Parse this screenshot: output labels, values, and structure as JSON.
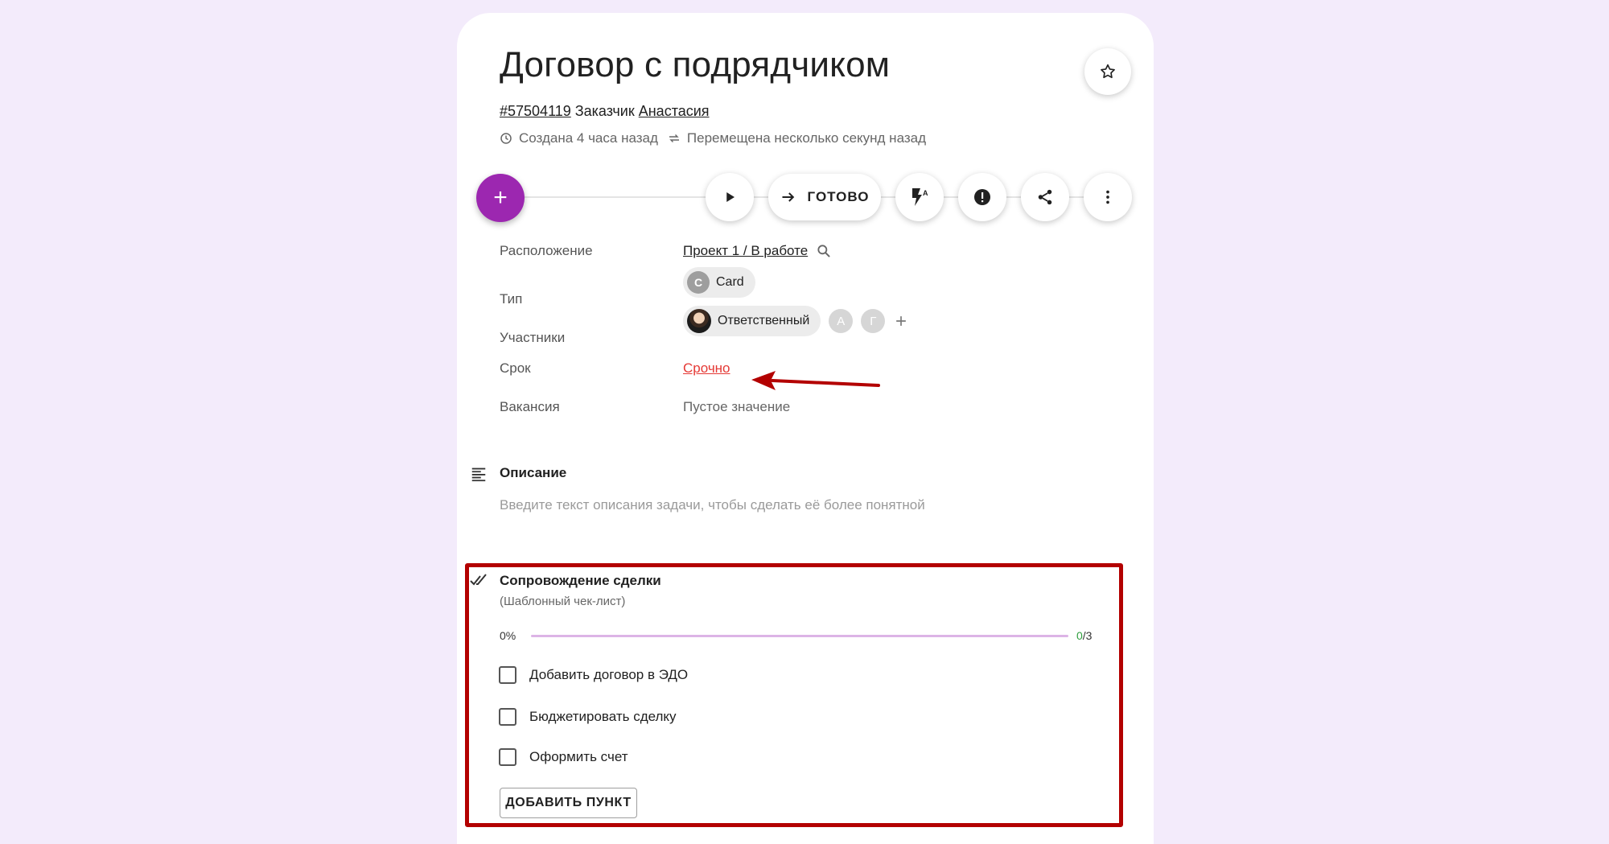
{
  "colors": {
    "page_bg": "#f3ebfb",
    "accent": "#9c27b0",
    "urgent": "#e53935",
    "annotation": "#b30000",
    "progress_track": "#dcb4e6",
    "progress_done": "#2e9e3e"
  },
  "task": {
    "title": "Договор с подрядчиком",
    "id": "#57504119",
    "customer_label": "Заказчик",
    "customer_name": "Анастасия",
    "created": "Создана 4 часа назад",
    "moved": "Перемещена несколько секунд назад"
  },
  "toolbar": {
    "add_icon": "plus-icon",
    "play_icon": "play-icon",
    "done_label": "ГОТОВО",
    "done_icon": "arrow-right-icon",
    "automation_icon": "flash-auto-icon",
    "priority_icon": "alert-circle-icon",
    "share_icon": "share-icon",
    "more_icon": "more-vertical-icon",
    "star_icon": "star-outline-icon"
  },
  "properties": {
    "location_label": "Расположение",
    "location_value": "Проект 1 / В работе",
    "type_label": "Тип",
    "type_letter": "C",
    "type_value": "Card",
    "participants_label": "Участники",
    "participant_role": "Ответственный",
    "participant_a": "А",
    "participant_g": "Г",
    "deadline_label": "Срок",
    "deadline_value": "Срочно",
    "vacancy_label": "Вакансия",
    "vacancy_value": "Пустое значение"
  },
  "description": {
    "title": "Описание",
    "placeholder": "Введите текст описания задачи, чтобы сделать её более понятной"
  },
  "checklist": {
    "title": "Сопровождение сделки",
    "subtitle": "(Шаблонный чек-лист)",
    "percent": "0%",
    "progress": 0,
    "done": "0",
    "total": "/3",
    "items": [
      {
        "label": "Добавить договор в ЭДО",
        "checked": false
      },
      {
        "label": "Бюджетировать сделку",
        "checked": false
      },
      {
        "label": "Оформить счет",
        "checked": false
      }
    ],
    "add_button": "ДОБАВИТЬ ПУНКТ"
  }
}
